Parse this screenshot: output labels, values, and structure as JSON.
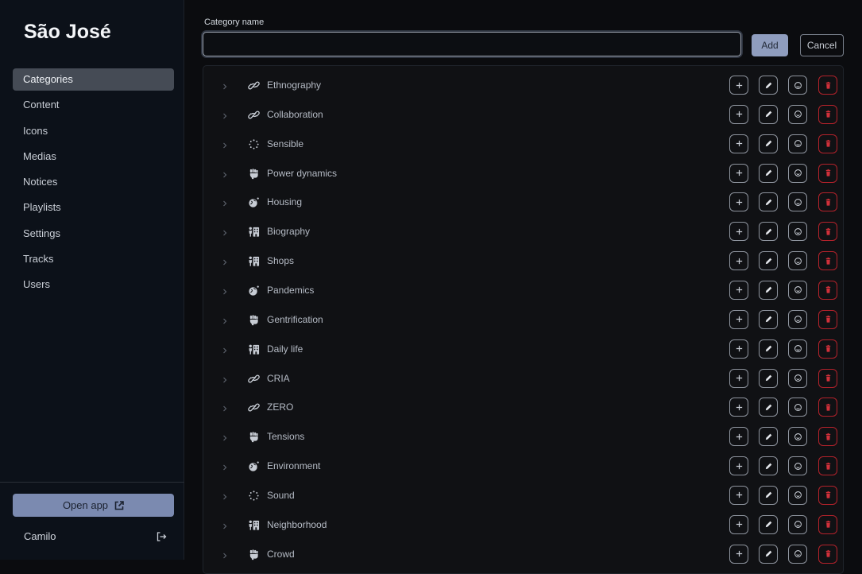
{
  "app": {
    "title": "São José"
  },
  "sidebar": {
    "items": [
      {
        "label": "Categories",
        "active": true
      },
      {
        "label": "Content"
      },
      {
        "label": "Icons"
      },
      {
        "label": "Medias"
      },
      {
        "label": "Notices"
      },
      {
        "label": "Playlists"
      },
      {
        "label": "Settings"
      },
      {
        "label": "Tracks"
      },
      {
        "label": "Users"
      }
    ],
    "open_app_label": "Open app",
    "user_name": "Camilo"
  },
  "form": {
    "label": "Category name",
    "value": "",
    "add_label": "Add",
    "cancel_label": "Cancel"
  },
  "categories": [
    {
      "label": "Ethnography",
      "icon": "link-icon"
    },
    {
      "label": "Collaboration",
      "icon": "link-icon"
    },
    {
      "label": "Sensible",
      "icon": "spinner-icon"
    },
    {
      "label": "Power dynamics",
      "icon": "fist-icon"
    },
    {
      "label": "Housing",
      "icon": "globe-icon"
    },
    {
      "label": "Biography",
      "icon": "person-building-icon"
    },
    {
      "label": "Shops",
      "icon": "person-building-icon"
    },
    {
      "label": "Pandemics",
      "icon": "globe-icon"
    },
    {
      "label": "Gentrification",
      "icon": "fist-icon"
    },
    {
      "label": "Daily life",
      "icon": "person-building-icon"
    },
    {
      "label": "CRIA",
      "icon": "link-icon"
    },
    {
      "label": "ZERO",
      "icon": "link-icon"
    },
    {
      "label": "Tensions",
      "icon": "fist-icon"
    },
    {
      "label": "Environment",
      "icon": "globe-icon"
    },
    {
      "label": "Sound",
      "icon": "spinner-icon"
    },
    {
      "label": "Neighborhood",
      "icon": "person-building-icon"
    },
    {
      "label": "Crowd",
      "icon": "fist-icon"
    }
  ],
  "colors": {
    "active_nav": "#454b55",
    "accent": "#8f9dbe",
    "danger": "#b3222b"
  }
}
